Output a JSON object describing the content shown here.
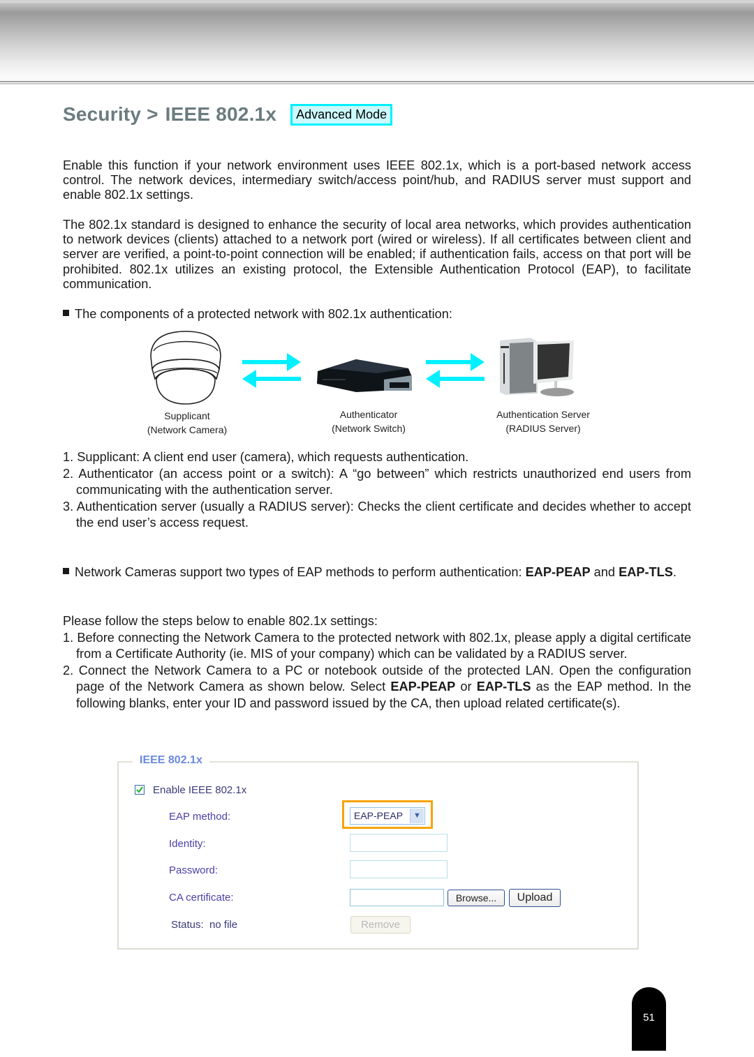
{
  "header": {
    "title_section": "Security",
    "title_separator": ">",
    "title_page": "IEEE 802.1x",
    "mode_badge": "Advanced Mode"
  },
  "intro": {
    "paragraph1": "Enable this function if your network environment uses IEEE 802.1x, which is a port-based network access control. The network devices, intermediary switch/access point/hub, and RADIUS server must support and enable 802.1x settings.",
    "paragraph2": "The 802.1x standard is designed to enhance the security of local area networks, which provides authentication to network devices (clients) attached to a network port (wired or wireless). If all certificates between client and server are verified, a point-to-point connection will be enabled; if authentication fails, access on that port will be prohibited. 802.1x utilizes an existing protocol, the Extensible Authentication Protocol (EAP), to facilitate communication."
  },
  "components": {
    "heading": "The components of a protected network with 802.1x authentication:",
    "diagram": {
      "nodes": [
        {
          "label": "Supplicant",
          "sublabel": "(Network Camera)",
          "icon": "dome-camera-icon"
        },
        {
          "label": "Authenticator",
          "sublabel": "(Network Switch)",
          "icon": "network-switch-icon"
        },
        {
          "label": "Authentication Server",
          "sublabel": "(RADIUS Server)",
          "icon": "server-computer-icon"
        }
      ],
      "arrow_color": "#00f0ff"
    },
    "list": [
      {
        "num": "1.",
        "text": "Supplicant: A client end user (camera), which requests authentication."
      },
      {
        "num": "2.",
        "text": "Authenticator (an access point or a switch): A “go between” which restricts unauthorized end users from communicating with the authentication server."
      },
      {
        "num": "3.",
        "text": "Authentication server (usually a RADIUS server): Checks the client certificate and decides whether to accept the end user’s access request."
      }
    ]
  },
  "eap_note": {
    "prefix": "Network Cameras support two types of EAP methods to perform authentication: ",
    "method1": "EAP-PEAP",
    "joiner": " and ",
    "method2": "EAP-TLS",
    "suffix": "."
  },
  "steps": {
    "intro": "Please follow the steps below to enable 802.1x settings:",
    "step1": {
      "num": "1.",
      "text": "Before connecting the Network Camera to the protected network with 802.1x, please apply a digital certificate from a Certificate Authority (ie. MIS of your company) which can be validated by a RADIUS server."
    },
    "step2": {
      "num": "2.",
      "text_a": "Connect the Network Camera to a PC or notebook outside of the protected LAN. Open the configuration page of the Network Camera as shown below. Select ",
      "bold_a": "EAP-PEAP",
      "text_b": " or ",
      "bold_b": "EAP-TLS",
      "text_c": " as the EAP method. In the following blanks, enter your ID and password issued by the CA, then upload related certificate(s)."
    }
  },
  "settings_panel": {
    "legend": "IEEE 802.1x",
    "enable_label": "Enable IEEE 802.1x",
    "enable_checked": true,
    "eap_method_label": "EAP method:",
    "eap_method_value": "EAP-PEAP",
    "identity_label": "Identity:",
    "identity_value": "",
    "password_label": "Password:",
    "password_value": "",
    "ca_cert_label": "CA certificate:",
    "ca_cert_value": "",
    "browse_button": "Browse...",
    "upload_button": "Upload",
    "status_label": "Status:",
    "status_value": "no file",
    "remove_button": "Remove",
    "highlight_color": "#f6a400"
  },
  "footer": {
    "page_number": "51"
  }
}
